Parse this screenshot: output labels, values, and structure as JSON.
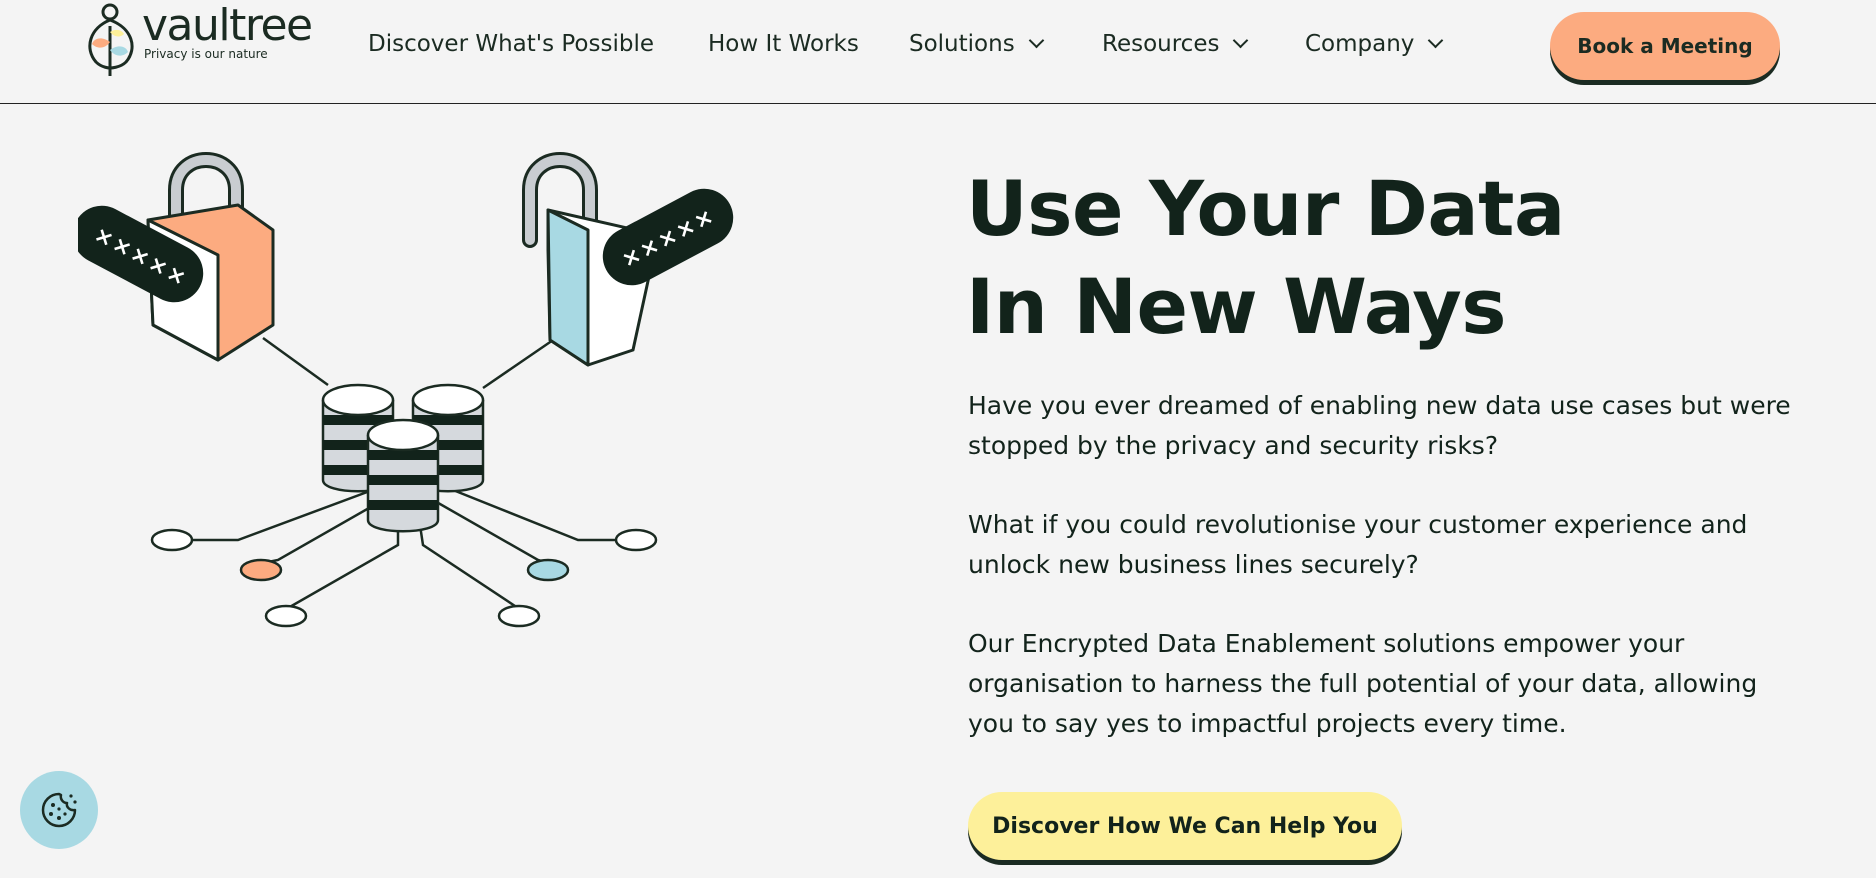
{
  "brand": {
    "name": "vaultree",
    "tagline": "Privacy is our nature",
    "colors": {
      "orange": "#fcab80",
      "blue": "#a8d9e3",
      "yellow": "#fdf09a",
      "dark": "#12231b"
    }
  },
  "nav": {
    "items": [
      {
        "label": "Discover What's Possible",
        "dropdown": false
      },
      {
        "label": "How It Works",
        "dropdown": false
      },
      {
        "label": "Solutions",
        "dropdown": true
      },
      {
        "label": "Resources",
        "dropdown": true
      },
      {
        "label": "Company",
        "dropdown": true
      }
    ],
    "cta_label": "Book a Meeting"
  },
  "hero": {
    "title_line1": "Use Your Data",
    "title_line2": "In New Ways",
    "paragraphs": [
      "Have you ever dreamed of enabling new data use cases but were stopped by the privacy and security risks?",
      "What if you could revolutionise your customer experience and unlock new business lines securely?",
      "Our Encrypted Data Enablement solutions empower your organisation to harness the full potential of your data, allowing you to say yes to impactful projects every time."
    ],
    "cta_label": "Discover How We Can Help You"
  },
  "illustration": {
    "left_lock_mask": "×××××",
    "right_lock_mask": "×××××"
  },
  "icons": {
    "cookie": "cookie-icon",
    "chevron": "chevron-down-icon"
  }
}
